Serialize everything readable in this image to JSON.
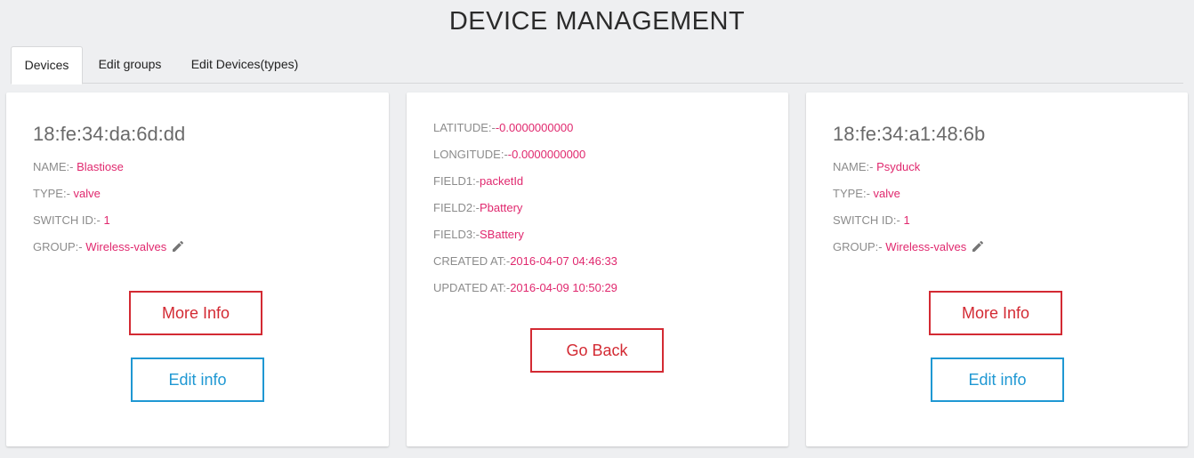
{
  "page": {
    "title": "DEVICE MANAGEMENT"
  },
  "tabs": [
    {
      "label": "Devices"
    },
    {
      "label": "Edit groups"
    },
    {
      "label": "Edit Devices(types)"
    }
  ],
  "card_left": {
    "mac": "18:fe:34:da:6d:dd",
    "name_label": "NAME:-",
    "name": " Blastiose",
    "type_label": "TYPE:-",
    "type": " valve",
    "switch_label": "SWITCH ID:-",
    "switch_id": " 1",
    "group_label": "GROUP:-",
    "group": " Wireless-valves",
    "more_info_label": "More Info",
    "edit_info_label": "Edit info"
  },
  "card_middle": {
    "latitude_label": "LATITUDE:-",
    "latitude": "-0.0000000000",
    "longitude_label": "LONGITUDE:-",
    "longitude": "-0.0000000000",
    "field1_label": "FIELD1:-",
    "field1": "packetId",
    "field2_label": "FIELD2:-",
    "field2": "Pbattery",
    "field3_label": "FIELD3:-",
    "field3": "SBattery",
    "created_label": "CREATED AT:-",
    "created": "2016-04-07 04:46:33",
    "updated_label": "UPDATED AT:-",
    "updated": "2016-04-09 10:50:29",
    "go_back_label": "Go Back"
  },
  "card_right": {
    "mac": "18:fe:34:a1:48:6b",
    "name_label": "NAME:-",
    "name": " Psyduck",
    "type_label": "TYPE:-",
    "type": " valve",
    "switch_label": "SWITCH ID:-",
    "switch_id": " 1",
    "group_label": "GROUP:-",
    "group": " Wireless-valves",
    "more_info_label": "More Info",
    "edit_info_label": "Edit info"
  },
  "colors": {
    "accent_value": "#e0286e",
    "button_red": "#d32a33",
    "button_blue": "#1f98d3",
    "background": "#eeeff1"
  },
  "icons": {
    "group_edit": "pencil-icon"
  }
}
